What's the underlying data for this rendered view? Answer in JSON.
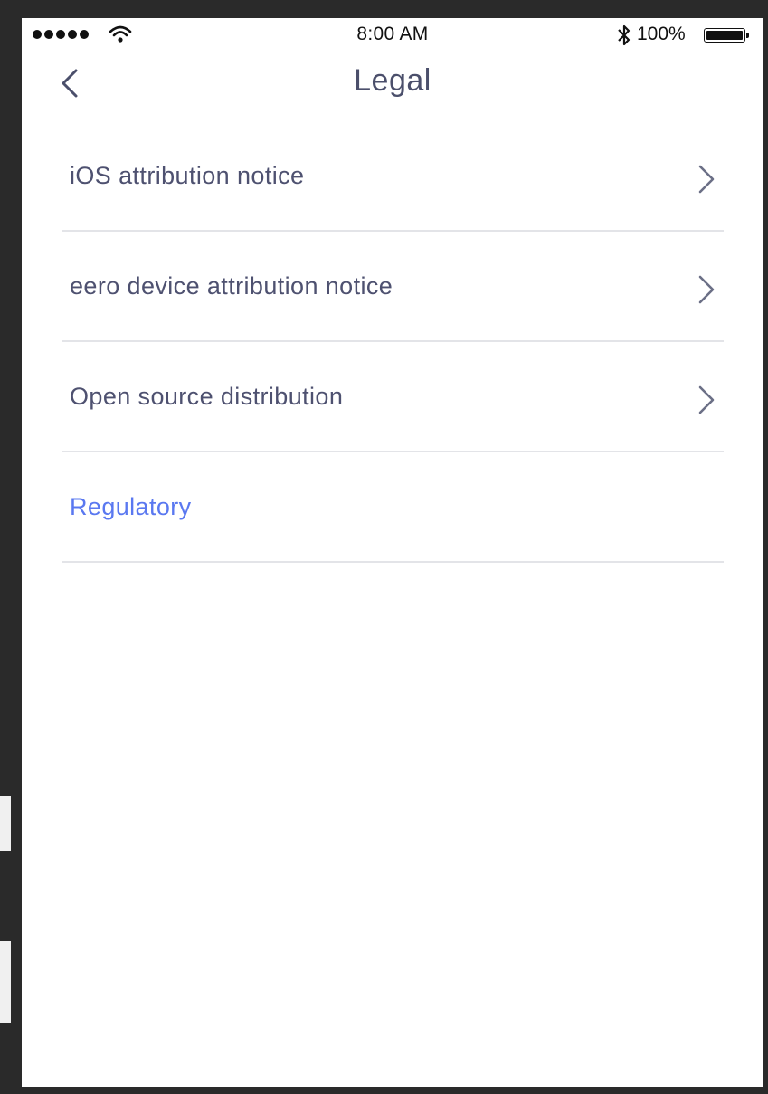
{
  "status_bar": {
    "time": "8:00 AM",
    "battery_percent": "100%",
    "signal_icon": "signal-dots-icon",
    "wifi_icon": "wifi-icon",
    "bluetooth_icon": "bluetooth-icon",
    "battery_icon": "battery-icon"
  },
  "nav": {
    "title": "Legal",
    "back_icon": "chevron-left-icon"
  },
  "list": {
    "items": [
      {
        "label": "iOS attribution notice",
        "has_chevron": true
      },
      {
        "label": "eero device attribution notice",
        "has_chevron": true
      },
      {
        "label": "Open source distribution",
        "has_chevron": true
      },
      {
        "label": "Regulatory",
        "has_chevron": false
      }
    ]
  },
  "colors": {
    "title_text": "#4b4f6b",
    "item_text": "#4e5170",
    "link_text": "#5a78f0",
    "divider": "#e3e4e8",
    "chevron": "#6b6f86"
  }
}
